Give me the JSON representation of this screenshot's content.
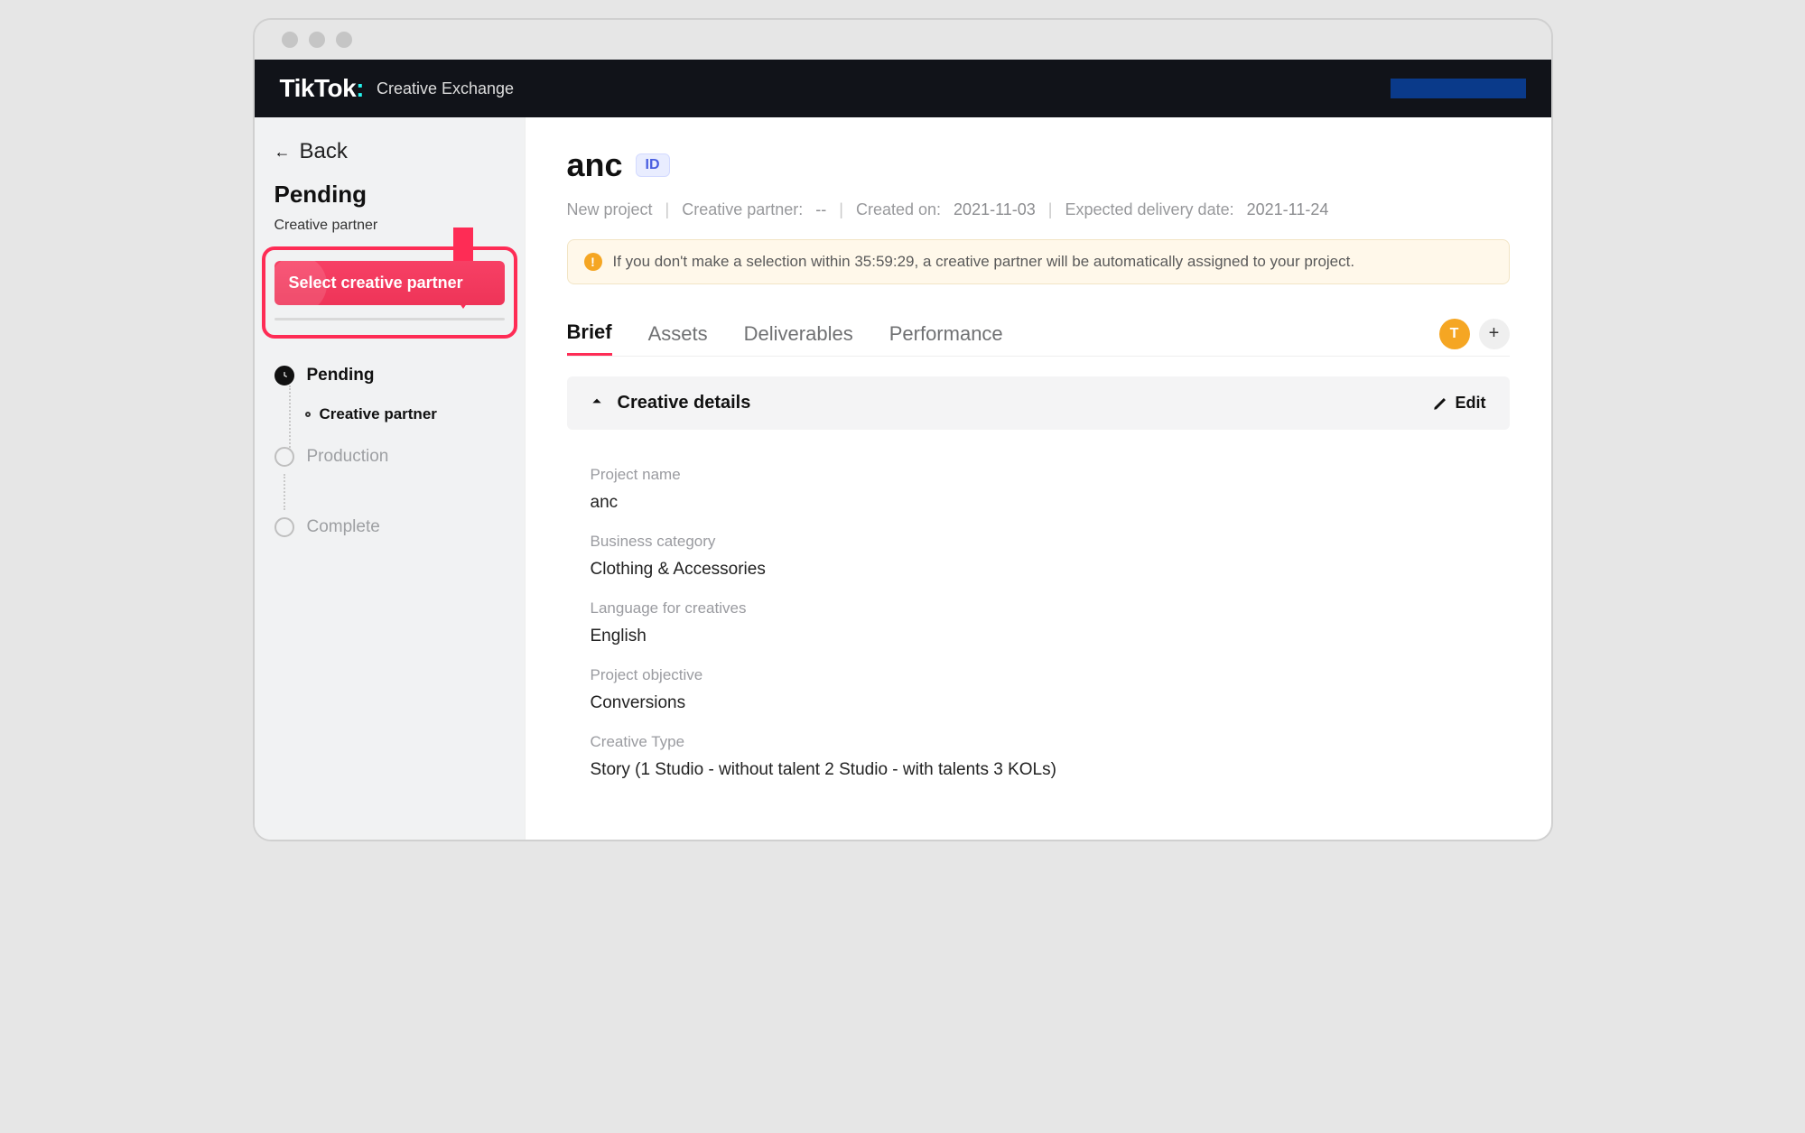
{
  "brand": {
    "name": "TikTok",
    "product": "Creative Exchange"
  },
  "sidebar": {
    "back": "Back",
    "heading": "Pending",
    "subheading": "Creative partner",
    "cta": "Select creative partner",
    "steps": {
      "pending": "Pending",
      "pending_sub": "Creative partner",
      "production": "Production",
      "complete": "Complete"
    }
  },
  "project": {
    "title": "anc",
    "id_badge": "ID",
    "status": "New project",
    "partner_label": "Creative partner:",
    "partner_value": "--",
    "created_label": "Created on:",
    "created_value": "2021-11-03",
    "expected_label": "Expected delivery date:",
    "expected_value": "2021-11-24"
  },
  "alert": {
    "text": "If you don't make a selection within 35:59:29, a creative partner will be automatically assigned to your project."
  },
  "tabs": {
    "brief": "Brief",
    "assets": "Assets",
    "deliverables": "Deliverables",
    "performance": "Performance"
  },
  "avatar_initial": "T",
  "panel": {
    "title": "Creative details",
    "edit": "Edit"
  },
  "details": [
    {
      "label": "Project name",
      "value": "anc"
    },
    {
      "label": "Business category",
      "value": "Clothing & Accessories"
    },
    {
      "label": "Language for creatives",
      "value": "English"
    },
    {
      "label": "Project objective",
      "value": "Conversions"
    },
    {
      "label": "Creative Type",
      "value": "Story (1 Studio - without talent 2 Studio - with talents 3 KOLs)"
    }
  ]
}
